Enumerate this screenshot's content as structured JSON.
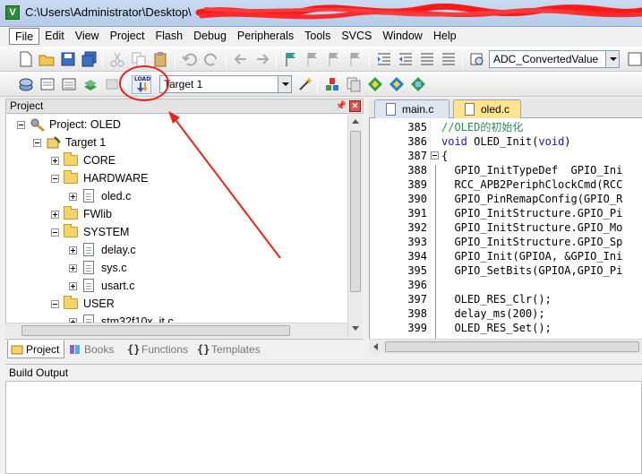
{
  "window": {
    "title": "C:\\Users\\Administrator\\Desktop\\",
    "app_icon_letter": "V"
  },
  "menu": [
    "File",
    "Edit",
    "View",
    "Project",
    "Flash",
    "Debug",
    "Peripherals",
    "Tools",
    "SVCS",
    "Window",
    "Help"
  ],
  "toolbar": {
    "find_combo_value": "ADC_ConvertedValue",
    "target_combo_value": "Target 1",
    "load_icon_text": "LOAD"
  },
  "project_panel": {
    "title": "Project",
    "tree": [
      {
        "label": "Project: OLED"
      },
      {
        "label": "Target 1"
      },
      {
        "label": "CORE"
      },
      {
        "label": "HARDWARE"
      },
      {
        "label": "oled.c"
      },
      {
        "label": "FWlib"
      },
      {
        "label": "SYSTEM"
      },
      {
        "label": "delay.c"
      },
      {
        "label": "sys.c"
      },
      {
        "label": "usart.c"
      },
      {
        "label": "USER"
      },
      {
        "label": "stm32f10x_it.c"
      }
    ],
    "tabs": [
      "Project",
      "Books",
      "Functions",
      "Templates"
    ]
  },
  "editor": {
    "tabs": [
      "main.c",
      "oled.c"
    ],
    "active_tab": "oled.c",
    "lines": [
      {
        "n": "385",
        "text": "//OLED的初始化"
      },
      {
        "n": "386",
        "text": "void OLED_Init(void)"
      },
      {
        "n": "387",
        "text": "{"
      },
      {
        "n": "388",
        "text": "  GPIO_InitTypeDef  GPIO_Ini"
      },
      {
        "n": "389",
        "text": "  RCC_APB2PeriphClockCmd(RCC"
      },
      {
        "n": "390",
        "text": "  GPIO_PinRemapConfig(GPIO_R"
      },
      {
        "n": "391",
        "text": "  GPIO_InitStructure.GPIO_Pi"
      },
      {
        "n": "392",
        "text": "  GPIO_InitStructure.GPIO_Mo"
      },
      {
        "n": "393",
        "text": "  GPIO_InitStructure.GPIO_Sp"
      },
      {
        "n": "394",
        "text": "  GPIO_Init(GPIOA, &GPIO_Ini"
      },
      {
        "n": "395",
        "text": "  GPIO_SetBits(GPIOA,GPIO_Pi"
      },
      {
        "n": "396",
        "text": ""
      },
      {
        "n": "397",
        "text": "  OLED_RES_Clr();"
      },
      {
        "n": "398",
        "text": "  delay_ms(200);"
      },
      {
        "n": "399",
        "text": "  OLED_RES_Set();"
      }
    ]
  },
  "build_output": {
    "title": "Build Output"
  },
  "colors": {
    "annotation_red": "#e8231b",
    "comment_green": "#2e8b57",
    "keyword_blue": "#1a1aa6",
    "active_tab_yellow": "#ffe48d"
  }
}
